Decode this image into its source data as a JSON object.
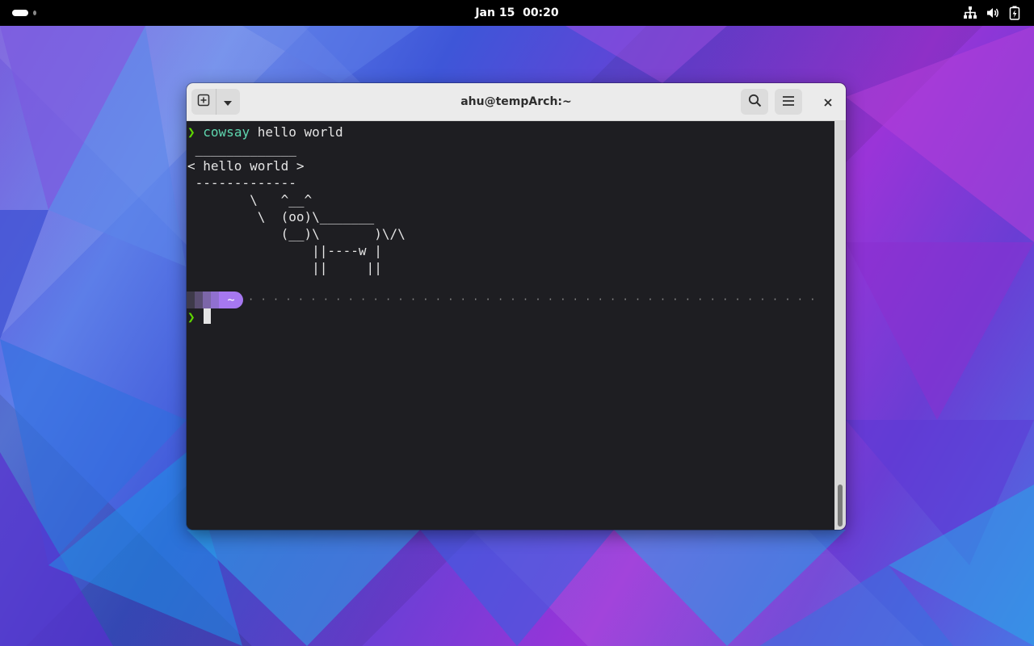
{
  "top_bar": {
    "clock": "Jan 15  00:20"
  },
  "window": {
    "title": "ahu@tempArch:~"
  },
  "terminal": {
    "prompt_glyph": "❯",
    "command": "cowsay",
    "args": " hello world",
    "output_lines": [
      " _____________",
      "< hello world >",
      " -------------",
      "        \\   ^__^",
      "         \\  (oo)\\_______",
      "            (__)\\       )\\/\\",
      "                ||----w |",
      "                ||     ||"
    ],
    "cwd_segment": "~",
    "dots": "· · · · · · · · · · · · · · · · · · · · · · · · · · · · · · · · · · · · · · · · · · · · · · · · · · · · · · · · · · · · · · · · · · · · · · · · · · · · · · · · · · · · · · · · · · · · · · · · · · · · · · · · · · · · · · · · ·"
  },
  "colors": {
    "prompt_green": "#5fd700",
    "command_teal": "#5fd7af",
    "cwd_purple": "#a678f0",
    "terminal_bg": "#1e1e22"
  },
  "icons": {
    "new_tab": "new-tab-icon",
    "dropdown": "chevron-down-icon",
    "search": "search-icon",
    "menu": "hamburger-menu-icon",
    "close": "close-icon",
    "network": "network-icon",
    "volume": "volume-icon",
    "battery": "battery-icon"
  }
}
